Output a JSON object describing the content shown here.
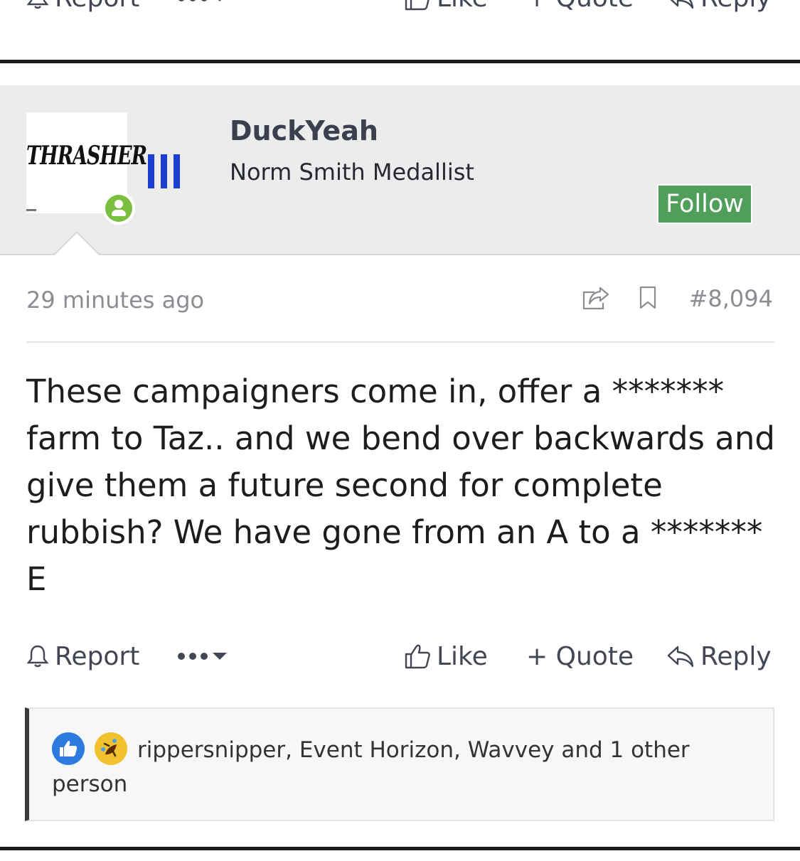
{
  "actions": {
    "report": "Report",
    "like": "Like",
    "quote": "+ Quote",
    "reply": "Reply"
  },
  "user": {
    "avatar_text": "THRASHER",
    "name": "DuckYeah",
    "title": "Norm Smith Medallist",
    "follow_label": "Follow"
  },
  "post": {
    "time": "29 minutes ago",
    "number": "#8,094",
    "body": "These campaigners come in, offer a ******* farm to Taz.. and we bend over backwards and give them a future second for complete rubbish? We have gone from an A to a ******* E"
  },
  "reactions": {
    "text": "rippersnipper, Event Horizon, Wavvey and 1 other person",
    "icons": [
      "like-icon",
      "laugh-icon"
    ]
  },
  "colors": {
    "follow": "#4f9e5a",
    "online": "#7bbf3e",
    "bars": "#1d3fd0"
  }
}
